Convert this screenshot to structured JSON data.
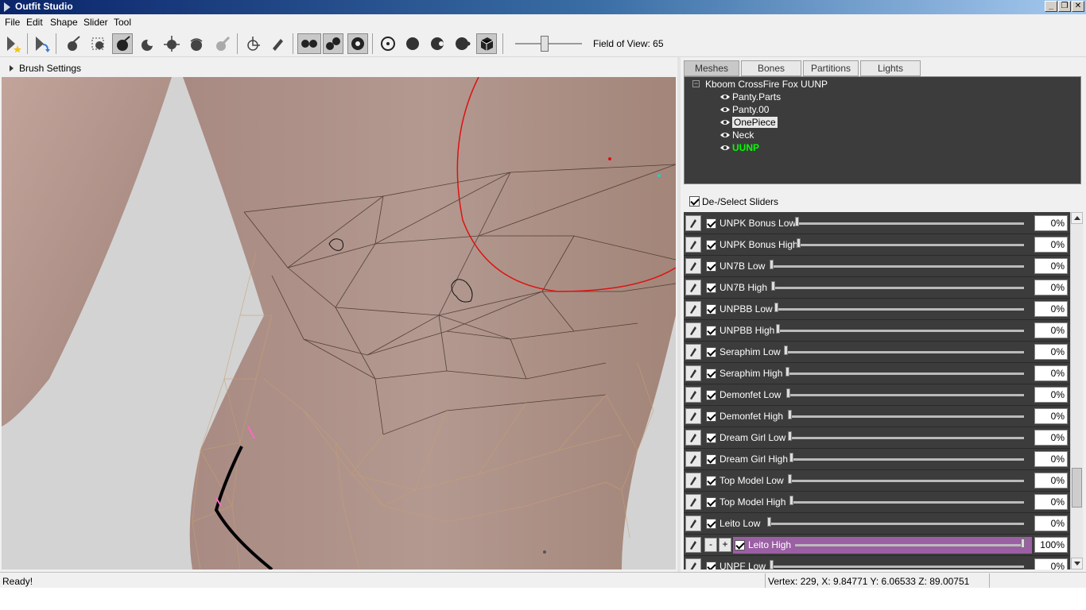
{
  "window": {
    "title": "Outfit Studio"
  },
  "menu": [
    "File",
    "Edit",
    "Shape",
    "Slider",
    "Tool"
  ],
  "toolbar": {
    "field_of_view_label": "Field of View: 65",
    "fov_slider_level_percent": 42
  },
  "brush_settings": {
    "label": "Brush Settings"
  },
  "tabs": [
    "Meshes",
    "Bones",
    "Partitions",
    "Lights"
  ],
  "active_tab": "Meshes",
  "tree": {
    "root": "Kboom CrossFire Fox UUNP",
    "items": [
      "Panty.Parts",
      "Panty.00",
      "OnePiece",
      "Neck",
      "UUNP"
    ],
    "selected": "OnePiece",
    "highlighted": "UUNP"
  },
  "deselect_label": "De-/Select Sliders",
  "sliders": [
    {
      "name": "UNPK Bonus Low",
      "value": "0%"
    },
    {
      "name": "UNPK Bonus High",
      "value": "0%"
    },
    {
      "name": "UN7B Low",
      "value": "0%"
    },
    {
      "name": "UN7B High",
      "value": "0%"
    },
    {
      "name": "UNPBB Low",
      "value": "0%"
    },
    {
      "name": "UNPBB High",
      "value": "0%"
    },
    {
      "name": "Seraphim Low",
      "value": "0%"
    },
    {
      "name": "Seraphim High",
      "value": "0%"
    },
    {
      "name": "Demonfet Low",
      "value": "0%"
    },
    {
      "name": "Demonfet High",
      "value": "0%"
    },
    {
      "name": "Dream Girl Low",
      "value": "0%"
    },
    {
      "name": "Dream Girl High",
      "value": "0%"
    },
    {
      "name": "Top Model Low",
      "value": "0%"
    },
    {
      "name": "Top Model High",
      "value": "0%"
    },
    {
      "name": "Leito Low",
      "value": "0%"
    },
    {
      "name": "Leito High",
      "value": "100%"
    },
    {
      "name": "UNPF Low",
      "value": "0%"
    }
  ],
  "active_slider": {
    "minus": "-",
    "plus": "+"
  },
  "status": {
    "message": "Ready!",
    "vertex_info": "Vertex: 229, X: 9.84771 Y: 6.06533 Z: 89.00751"
  },
  "colors": {
    "active_slider_bg": "#9b5fa4",
    "panel_bg": "#3c3c3c",
    "highlight_mesh": "#00ff00"
  }
}
